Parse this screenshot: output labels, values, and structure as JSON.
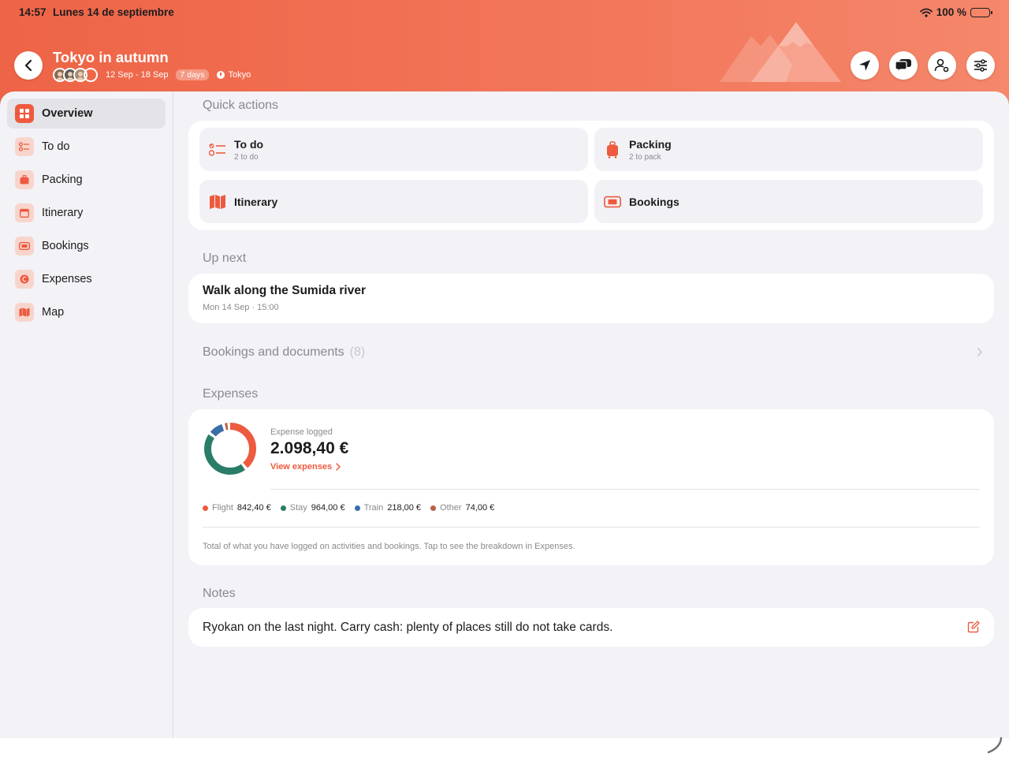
{
  "status": {
    "time": "14:57",
    "date": "Lunes 14 de septiembre",
    "battery": "100 %"
  },
  "trip": {
    "title": "Tokyo in autumn",
    "dates": "12 Sep - 18 Sep",
    "days": "7 days",
    "location": "Tokyo"
  },
  "sidebar": {
    "items": [
      {
        "label": "Overview",
        "icon": "grid-icon",
        "active": true
      },
      {
        "label": "To do",
        "icon": "checklist-icon"
      },
      {
        "label": "Packing",
        "icon": "suitcase-icon"
      },
      {
        "label": "Itinerary",
        "icon": "calendar-icon"
      },
      {
        "label": "Bookings",
        "icon": "ticket-icon"
      },
      {
        "label": "Expenses",
        "icon": "euro-coin-icon"
      },
      {
        "label": "Map",
        "icon": "map-icon"
      }
    ]
  },
  "quick_actions": {
    "title": "Quick actions",
    "tiles": [
      {
        "title": "To do",
        "subtitle": "2 to do",
        "icon": "checklist-icon"
      },
      {
        "title": "Packing",
        "subtitle": "2 to pack",
        "icon": "suitcase-icon"
      },
      {
        "title": "Itinerary",
        "subtitle": "",
        "icon": "map-icon"
      },
      {
        "title": "Bookings",
        "subtitle": "",
        "icon": "ticket-icon"
      }
    ]
  },
  "up_next": {
    "title": "Up next",
    "event": "Walk along the Sumida river",
    "when": "Mon 14 Sep · 15:00"
  },
  "documents": {
    "label": "Bookings and documents",
    "count": "(8)"
  },
  "expenses": {
    "title": "Expenses",
    "label": "Expense logged",
    "total": "2.098,40 €",
    "link": "View expenses",
    "footnote": "Total of what you have logged on activities and bookings. Tap to see the breakdown in Expenses.",
    "categories": [
      {
        "name": "Flight",
        "amount": "842,40 €",
        "value": 842.4,
        "color": "#ee5a3f"
      },
      {
        "name": "Stay",
        "amount": "964,00 €",
        "value": 964.0,
        "color": "#2a7d68"
      },
      {
        "name": "Train",
        "amount": "218,00 €",
        "value": 218.0,
        "color": "#3a6eab"
      },
      {
        "name": "Other",
        "amount": "74,00 €",
        "value": 74.0,
        "color": "#b86048"
      }
    ]
  },
  "notes": {
    "title": "Notes",
    "text": "Ryokan on the last night. Carry cash: plenty of places still do not take cards."
  },
  "colors": {
    "accent": "#ee5a3f",
    "header_start": "#ee6446",
    "header_end": "#f5876b",
    "background": "#f2f2f7"
  }
}
